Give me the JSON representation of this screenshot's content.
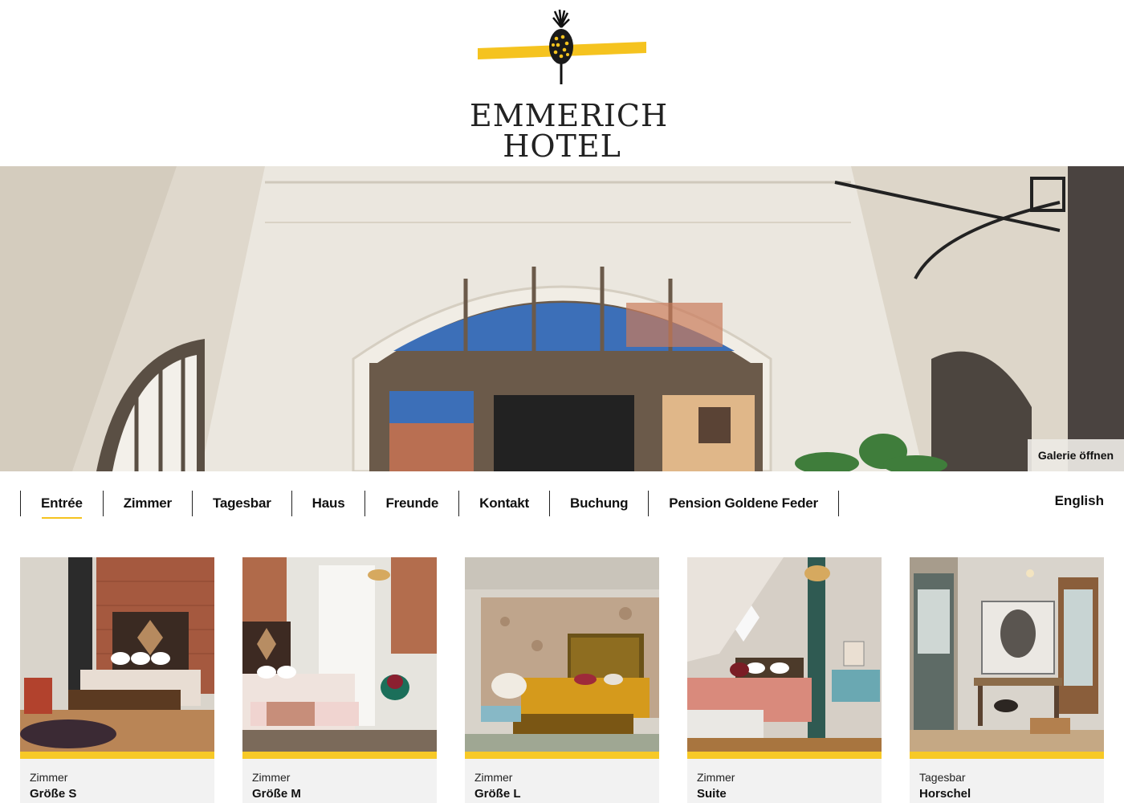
{
  "brand": {
    "line1": "EMMERICH",
    "line2": "HOTEL",
    "accent": "#f5c31f"
  },
  "hero": {
    "gallery_label": "Galerie öffnen"
  },
  "nav": {
    "items": [
      {
        "label": "Entrée",
        "active": true
      },
      {
        "label": "Zimmer"
      },
      {
        "label": "Tagesbar"
      },
      {
        "label": "Haus"
      },
      {
        "label": "Freunde"
      },
      {
        "label": "Kontakt"
      },
      {
        "label": "Buchung"
      },
      {
        "label": "Pension Goldene Feder"
      }
    ],
    "language": "English"
  },
  "cards": [
    {
      "category": "Zimmer",
      "title": "Größe S"
    },
    {
      "category": "Zimmer",
      "title": "Größe M"
    },
    {
      "category": "Zimmer",
      "title": "Größe L"
    },
    {
      "category": "Zimmer",
      "title": "Suite"
    },
    {
      "category": "Tagesbar",
      "title": "Horschel"
    }
  ]
}
